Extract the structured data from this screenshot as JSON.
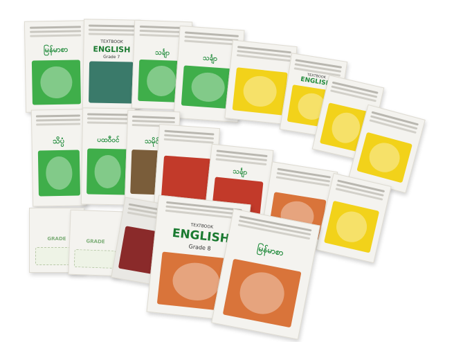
{
  "photo": {
    "description_colors": {
      "background": "#ffffff",
      "cover_green": "#3fae4a",
      "cover_yellow": "#f2d21a",
      "cover_orange": "#d9743a",
      "cover_red": "#c23a2a"
    },
    "books": [
      {
        "id": "b1",
        "title": "မြန်မာစာ",
        "subtitle": "",
        "style": "green"
      },
      {
        "id": "b2",
        "title": "ENGLISH",
        "subtitle": "Grade 7",
        "header": "TEXTBOOK",
        "style": "green"
      },
      {
        "id": "b3",
        "title": "သင်္ချာ",
        "subtitle": "",
        "style": "green"
      },
      {
        "id": "b4",
        "title": "သင်္ချာ",
        "subtitle": "",
        "style": "green"
      },
      {
        "id": "b5",
        "title": "",
        "subtitle": "",
        "style": "yellow"
      },
      {
        "id": "b6",
        "title": "ENGLISH",
        "subtitle": "",
        "header": "TEXTBOOK",
        "style": "yellow"
      },
      {
        "id": "b7",
        "title": "",
        "subtitle": "",
        "style": "yellow"
      },
      {
        "id": "b8",
        "title": "",
        "subtitle": "",
        "style": "yellow"
      },
      {
        "id": "b9",
        "title": "သိပ္ပံ",
        "subtitle": "",
        "style": "green"
      },
      {
        "id": "b10",
        "title": "ပထဝီဝင်",
        "subtitle": "",
        "style": "green"
      },
      {
        "id": "b11",
        "title": "သမိုင်း",
        "subtitle": "",
        "style": "green"
      },
      {
        "id": "b12",
        "title": "",
        "subtitle": "",
        "style": "orange"
      },
      {
        "id": "b13",
        "title": "သင်္ချာ",
        "subtitle": "",
        "style": "red"
      },
      {
        "id": "b14",
        "title": "",
        "subtitle": "",
        "style": "orange"
      },
      {
        "id": "b15",
        "title": "",
        "subtitle": "",
        "style": "yellow"
      },
      {
        "id": "b16",
        "title": "ENGLISH",
        "subtitle": "Grade 8",
        "header": "TEXTBOOK",
        "style": "orange"
      },
      {
        "id": "b17",
        "title": "မြန်မာစာ",
        "subtitle": "",
        "style": "orange"
      },
      {
        "id": "b18",
        "title": "GRADE",
        "subtitle": "",
        "style": "pale"
      },
      {
        "id": "b19",
        "title": "GRADE",
        "subtitle": "",
        "style": "pale"
      },
      {
        "id": "b20",
        "title": "",
        "subtitle": "",
        "style": "dkred"
      }
    ]
  }
}
